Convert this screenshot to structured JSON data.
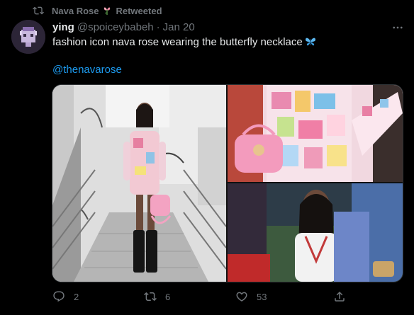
{
  "retweet": {
    "name": "Nava Rose",
    "label": "Retweeted"
  },
  "author": {
    "name": "ying",
    "handle": "@spoiceybabeh",
    "separator": "·",
    "date": "Jan 20"
  },
  "tweet": {
    "text": "fashion icon nava rose wearing the butterfly necklace",
    "mention": "@thenavarose"
  },
  "stats": {
    "replies": "2",
    "retweets": "6",
    "likes": "53"
  },
  "icons": [
    "retweet-icon",
    "flower-icon",
    "more-icon",
    "butterfly-icon",
    "reply-icon",
    "retweet-icon",
    "like-icon",
    "share-icon"
  ],
  "colors": {
    "background": "#000000",
    "text": "#e7e9ea",
    "muted": "#71767b",
    "link": "#1d9bf0"
  }
}
